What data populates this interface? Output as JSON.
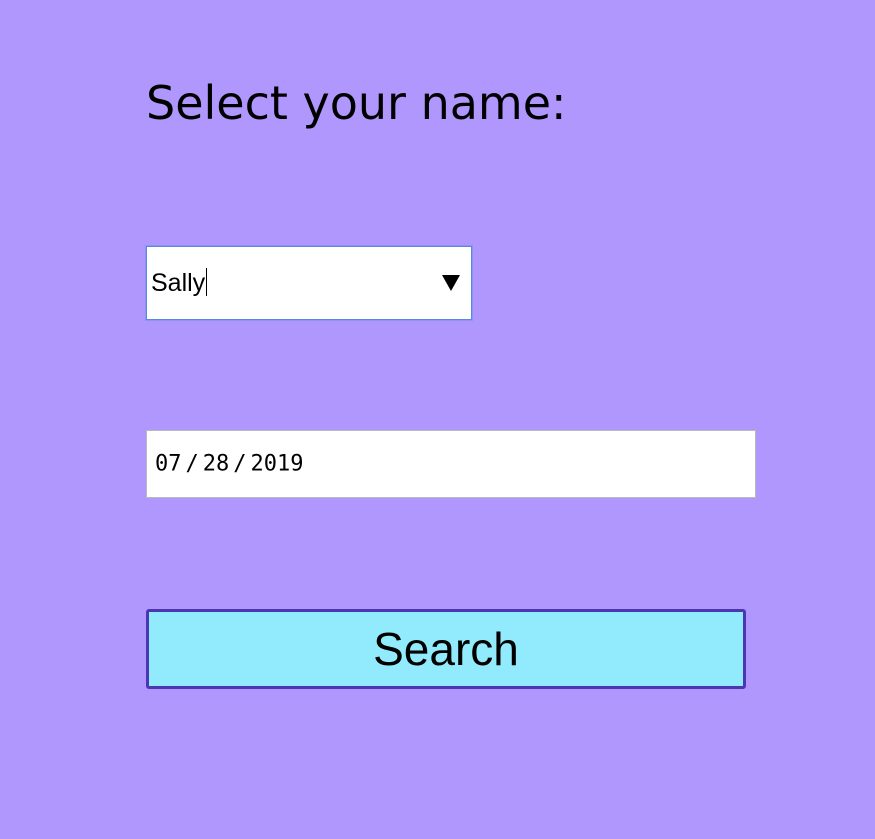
{
  "form": {
    "heading": "Select your name:",
    "name_select": {
      "selected_value": "Sally"
    },
    "date_input": {
      "month": "07",
      "day": "28",
      "year": "2019",
      "separator": "/"
    },
    "search_label": "Search"
  },
  "colors": {
    "background": "#af97fe",
    "button_fill": "#91ebfd",
    "button_border": "#4b38b0",
    "select_focus_border": "#5a86e8"
  },
  "icons": {
    "dropdown": "dropdown-arrow-icon"
  }
}
